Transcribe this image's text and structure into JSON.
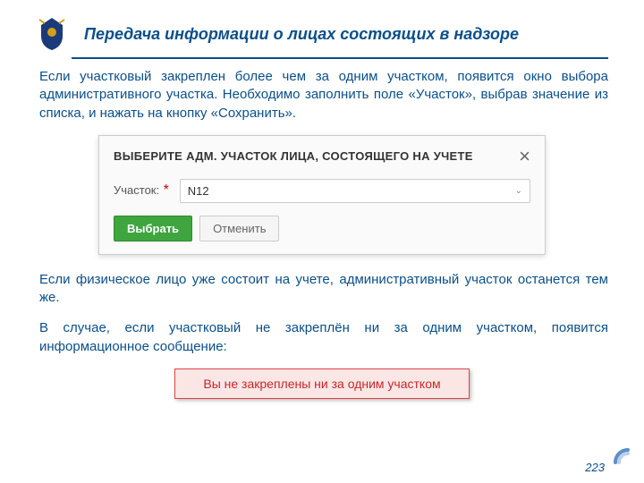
{
  "header": {
    "title": "Передача информации о лицах состоящих в надзоре"
  },
  "paragraphs": {
    "p1": "Если участковый закреплен более чем за одним участком, появится окно выбора административного участка. Необходимо заполнить поле «Участок», выбрав значение из списка, и нажать на кнопку «Сохранить».",
    "p2": "Если физическое лицо уже состоит на учете, административный участок останется тем же.",
    "p3": "В случае, если участковый не закреплён ни за одним участком, появится информационное сообщение:"
  },
  "dialog": {
    "title": "ВЫБЕРИТЕ АДМ. УЧАСТОК ЛИЦА, СОСТОЯЩЕГО НА УЧЕТЕ",
    "field_label": "Участок:",
    "required_mark": "*",
    "selected_value": "N12",
    "btn_primary": "Выбрать",
    "btn_secondary": "Отменить"
  },
  "alert": {
    "text": "Вы не закреплены ни за одним участком"
  },
  "page_number": "223"
}
